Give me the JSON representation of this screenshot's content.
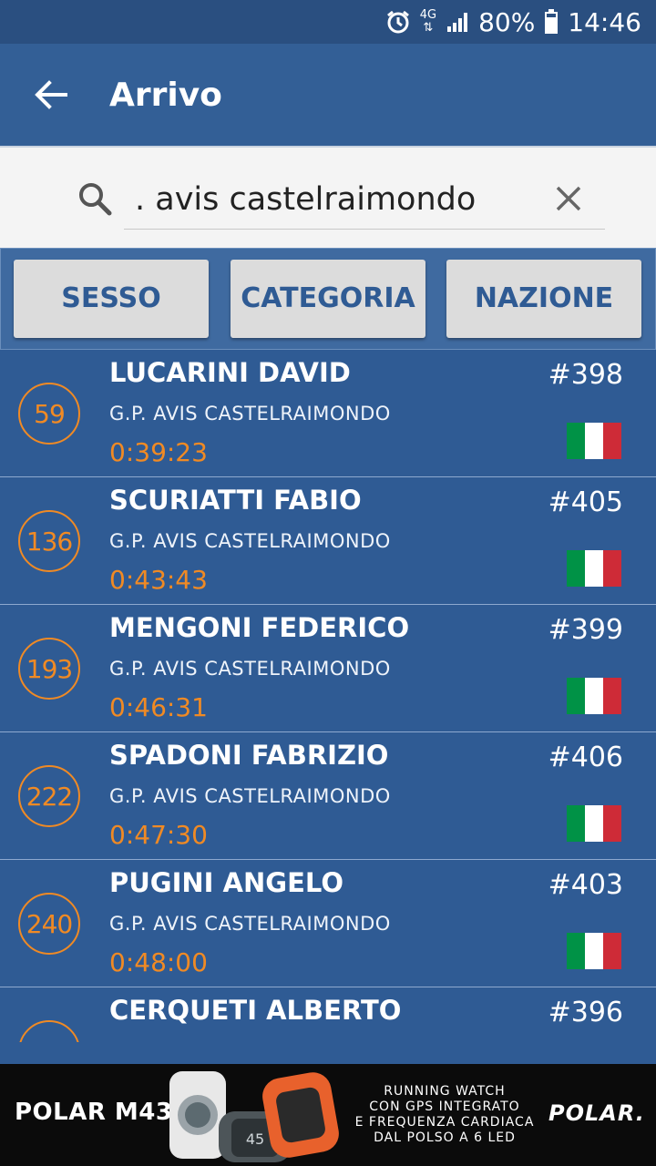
{
  "status_bar": {
    "network": "4G",
    "battery": "80%",
    "time": "14:46",
    "icons": [
      "alarm-icon",
      "network-4g-icon",
      "signal-icon",
      "battery-icon"
    ]
  },
  "app_bar": {
    "title": "Arrivo"
  },
  "search": {
    "value": ". avis castelraimondo",
    "placeholder": ""
  },
  "filters": [
    {
      "label": "SESSO"
    },
    {
      "label": "CATEGORIA"
    },
    {
      "label": "NAZIONE"
    }
  ],
  "results": [
    {
      "position": "59",
      "name": "LUCARINI DAVID",
      "club": "G.P. AVIS CASTELRAIMONDO",
      "time": "0:39:23",
      "bib": "#398",
      "nation": "italy"
    },
    {
      "position": "136",
      "name": "SCURIATTI FABIO",
      "club": "G.P. AVIS CASTELRAIMONDO",
      "time": "0:43:43",
      "bib": "#405",
      "nation": "italy"
    },
    {
      "position": "193",
      "name": "MENGONI FEDERICO",
      "club": "G.P. AVIS CASTELRAIMONDO",
      "time": "0:46:31",
      "bib": "#399",
      "nation": "italy"
    },
    {
      "position": "222",
      "name": "SPADONI FABRIZIO",
      "club": "G.P. AVIS CASTELRAIMONDO",
      "time": "0:47:30",
      "bib": "#406",
      "nation": "italy"
    },
    {
      "position": "240",
      "name": "PUGINI ANGELO",
      "club": "G.P. AVIS CASTELRAIMONDO",
      "time": "0:48:00",
      "bib": "#403",
      "nation": "italy"
    },
    {
      "position": "",
      "name": "CERQUETI ALBERTO",
      "club": "",
      "time": "",
      "bib": "#396",
      "nation": ""
    }
  ],
  "ad": {
    "product": "POLAR M430",
    "text_lines": [
      "RUNNING WATCH",
      "CON GPS INTEGRATO",
      "E FREQUENZA CARDIACA",
      "DAL POLSO A 6 LED"
    ],
    "brand": "POLAR."
  },
  "colors": {
    "status_bar": "#2a4f80",
    "app_bar": "#335f96",
    "list_background": "#2f5b94",
    "accent_orange": "#f08a24",
    "flag_green": "#009246",
    "flag_white": "#ffffff",
    "flag_red": "#ce2b37"
  }
}
